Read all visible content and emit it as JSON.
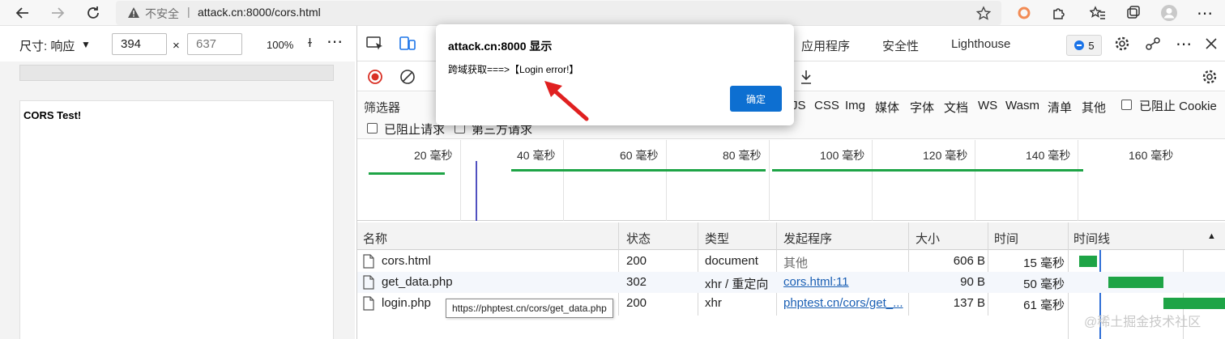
{
  "browser": {
    "security_label": "不安全",
    "url_separator": "|",
    "url": "attack.cn:8000/cors.html"
  },
  "device_toolbar": {
    "dimensions_label": "尺寸: 响应",
    "width": "394",
    "height": "637",
    "times": "×",
    "zoom": "100%",
    "rotate_glyph": "ɫ",
    "more": "⋯"
  },
  "page": {
    "heading": "CORS Test!"
  },
  "devtools": {
    "tabs": [
      "应用程序",
      "安全性",
      "Lighthouse"
    ],
    "issues_count": "5",
    "filter_label": "筛选器",
    "filter_types": [
      "JS",
      "CSS",
      "Img",
      "媒体",
      "字体",
      "文档",
      "WS",
      "Wasm",
      "清单",
      "其他"
    ],
    "blocked_cookies_label": "已阻止 Cookie",
    "blocked_requests_label": "已阻止请求",
    "third_party_label": "第三方请求",
    "overview_labels": [
      "20  毫秒",
      "40  毫秒",
      "60  毫秒",
      "80  毫秒",
      "100  毫秒",
      "120  毫秒",
      "140  毫秒",
      "160  毫秒"
    ],
    "columns": [
      "名称",
      "状态",
      "类型",
      "发起程序",
      "大小",
      "时间",
      "时间线"
    ],
    "requests": [
      {
        "name": "cors.html",
        "status": "200",
        "type": "document",
        "initiator": "其他",
        "size": "606 B",
        "time": "15  毫秒"
      },
      {
        "name": "get_data.php",
        "status": "302",
        "type": "xhr / 重定向",
        "initiator": "cors.html:11",
        "size": "90 B",
        "time": "50  毫秒"
      },
      {
        "name": "login.php",
        "status": "200",
        "type": "xhr",
        "initiator": "phptest.cn/cors/get_...",
        "size": "137 B",
        "time": "61  毫秒"
      }
    ],
    "tooltip": "https://phptest.cn/cors/get_data.php"
  },
  "alert": {
    "title": "attack.cn:8000 显示",
    "message": "跨域获取===>【Login error!】",
    "ok_label": "确定"
  },
  "watermark": "@稀土掘金技术社区",
  "colors": {
    "accent_blue": "#0d6fd1",
    "waterfall_green": "#1ea446",
    "record_red": "#d93025",
    "arrow_red": "#e02020"
  }
}
